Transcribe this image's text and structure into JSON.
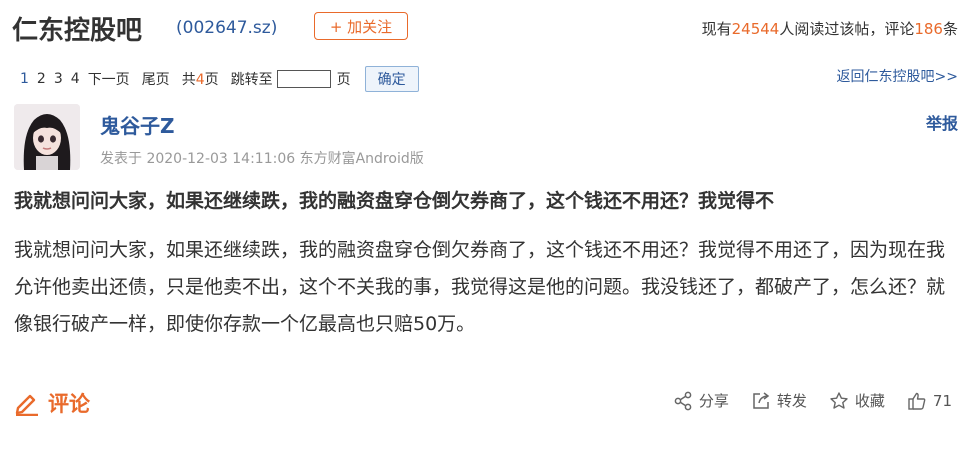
{
  "header": {
    "forum_title": "仁东控股吧",
    "stock_code": "(002647.sz)",
    "follow_label": "+ 加关注",
    "stats": {
      "prefix": "现有",
      "readers": "24544",
      "mid": "人阅读过该帖，评论",
      "comments": "186",
      "suffix": "条"
    }
  },
  "pager": {
    "pages": [
      "1",
      "2",
      "3",
      "4"
    ],
    "next": "下一页",
    "last": "尾页",
    "total_prefix": "共",
    "total_num": "4",
    "total_suffix": "页",
    "jump_label": "跳转至",
    "jump_value": "",
    "page_unit": "页",
    "confirm": "确定",
    "back_link": "返回仁东控股吧>>"
  },
  "post": {
    "username": "鬼谷子Z",
    "report": "举报",
    "meta": "发表于 2020-12-03 14:11:06 东方财富Android版",
    "title": "我就想问问大家，如果还继续跌，我的融资盘穿仓倒欠券商了，这个钱还不用还？我觉得不",
    "body": "我就想问问大家，如果还继续跌，我的融资盘穿仓倒欠券商了，这个钱还不用还？我觉得不用还了，因为现在我允许他卖出还债，只是他卖不出，这个不关我的事，我觉得这是他的问题。我没钱还了，都破产了，怎么还？就像银行破产一样，即使你存款一个亿最高也只赔50万。"
  },
  "footer": {
    "comment_label": "评论",
    "share": "分享",
    "forward": "转发",
    "collect": "收藏",
    "likes": "71"
  },
  "colors": {
    "accent": "#e96a2b",
    "link": "#2e5a9c"
  }
}
